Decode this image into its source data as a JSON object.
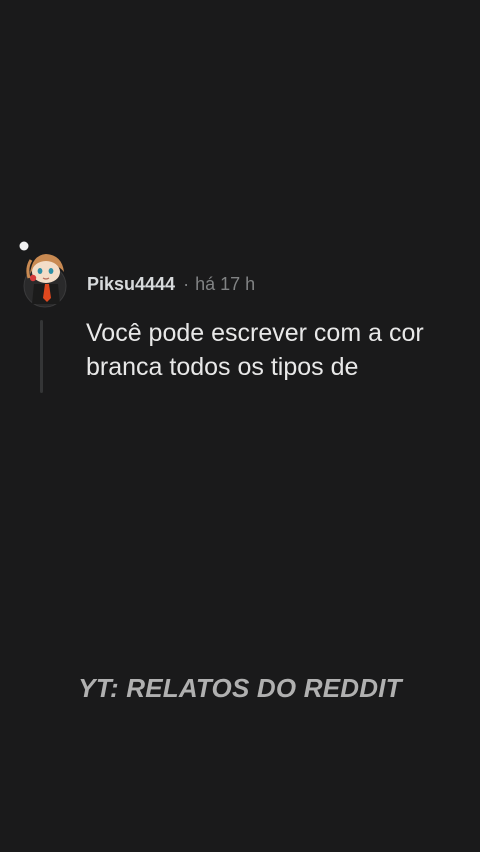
{
  "comment": {
    "avatar_icon": "snoo-avatar-icon",
    "username": "Piksu4444",
    "separator": "·",
    "timestamp": "há 17 h",
    "text": "Você pode escrever com a cor branca todos os tipos de"
  },
  "watermark": {
    "text": "YT: RELATOS DO REDDIT"
  },
  "colors": {
    "background": "#1a1a1b",
    "text_primary": "#d7dadc",
    "text_muted": "#818384",
    "thread_line": "#343536",
    "watermark": "#b0b0b0"
  }
}
